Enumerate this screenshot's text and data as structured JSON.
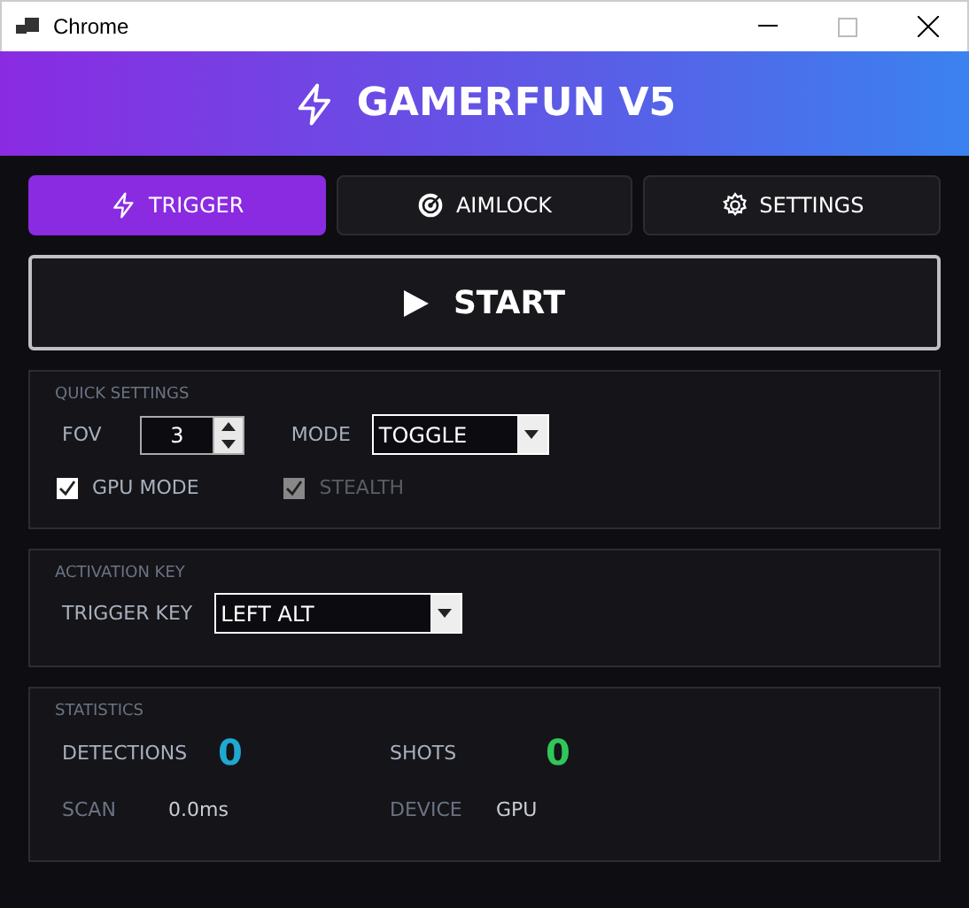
{
  "window": {
    "title": "Chrome"
  },
  "header": {
    "title": "GAMERFUN V5"
  },
  "tabs": [
    {
      "label": "TRIGGER",
      "kind": "bolt",
      "selected": true
    },
    {
      "label": "AIMLOCK",
      "kind": "target",
      "selected": false
    },
    {
      "label": "SETTINGS",
      "kind": "gear",
      "selected": false
    }
  ],
  "start_button": {
    "label": "START"
  },
  "quick_settings": {
    "title": "QUICK SETTINGS",
    "fov_label": "FOV",
    "fov_value": "3",
    "mode_label": "MODE",
    "mode_value": "TOGGLE",
    "checkboxes": [
      {
        "label": "GPU MODE",
        "checked": true,
        "disabled": false
      },
      {
        "label": "STEALTH",
        "checked": true,
        "disabled": true
      }
    ]
  },
  "activation_key": {
    "title": "ACTIVATION KEY",
    "label": "TRIGGER KEY",
    "value": "LEFT ALT"
  },
  "statistics": {
    "title": "STATISTICS",
    "items": [
      {
        "label": "DETECTIONS",
        "value": "0",
        "color": "#1fa8d0"
      },
      {
        "label": "SHOTS",
        "value": "0",
        "color": "#2fc75a"
      },
      {
        "label": "SCAN",
        "value": "0.0ms"
      },
      {
        "label": "DEVICE",
        "value": "GPU"
      }
    ]
  }
}
